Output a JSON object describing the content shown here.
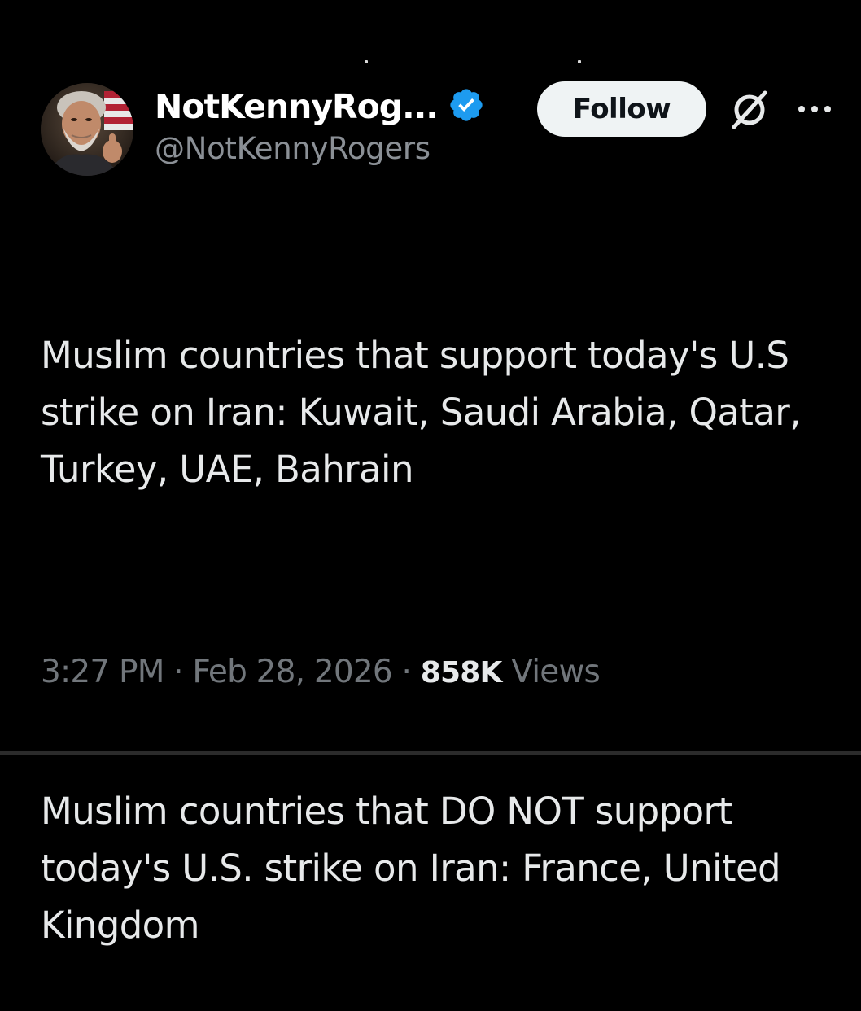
{
  "tweet": {
    "author": {
      "display_name": "NotKennyRog...",
      "handle": "@NotKennyRogers",
      "verified": true,
      "avatar_icon": "avatar-photo"
    },
    "follow_label": "Follow",
    "text_paragraph_1": "Muslim countries that support today's U.S strike on Iran: Kuwait, Saudi Arabia, Qatar, Turkey, UAE, Bahrain",
    "text_paragraph_2": "Muslim countries that DO NOT support today's U.S. strike on Iran: France, United Kingdom",
    "time": "3:27 PM",
    "date": "Feb 28, 2026",
    "separator": "·",
    "views_count": "858K",
    "views_label": "Views"
  },
  "icons": {
    "verified": "verified-badge-icon",
    "grok": "grok-icon",
    "more": "more-options-icon"
  },
  "colors": {
    "background": "#000000",
    "text_primary": "#e7e9ea",
    "text_secondary": "#71767b",
    "verified_blue": "#1d9bf0",
    "follow_bg": "#eff3f4"
  }
}
